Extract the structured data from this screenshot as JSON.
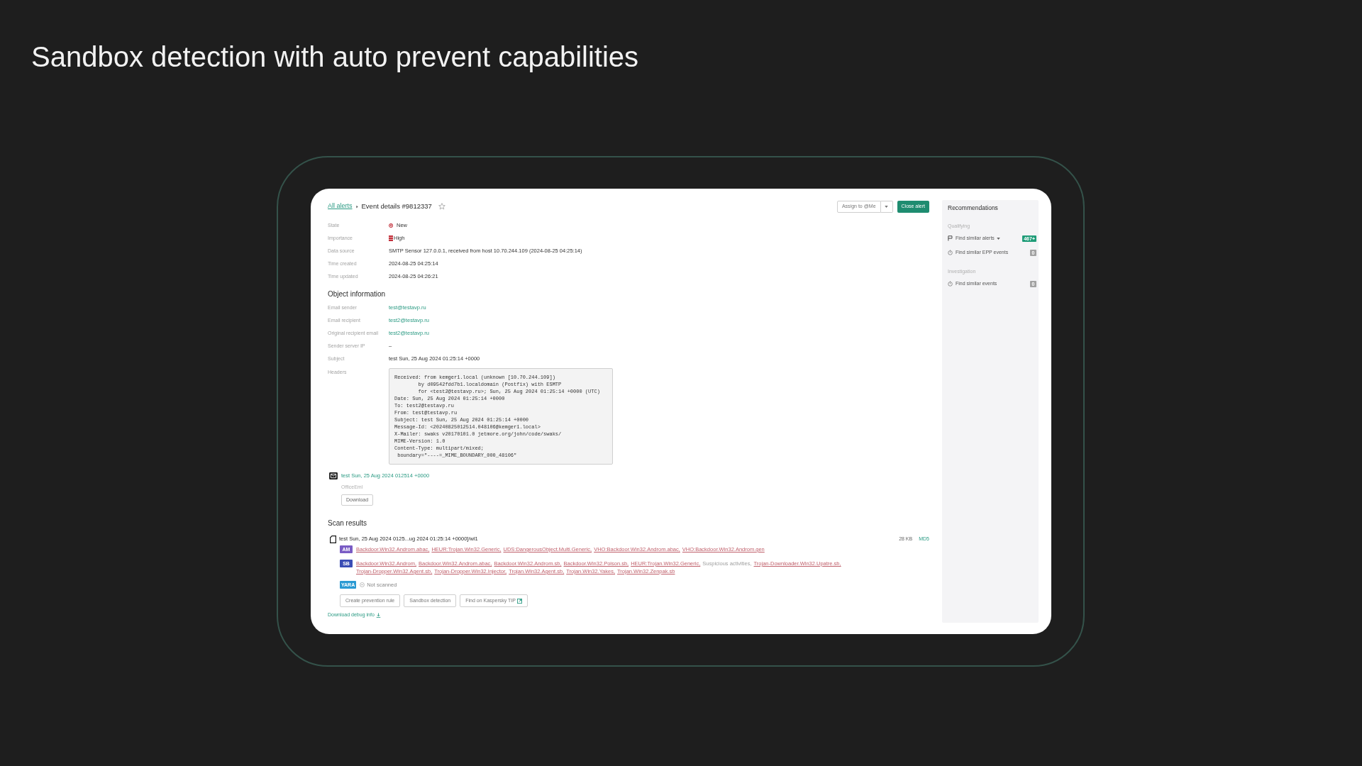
{
  "slide_title": "Sandbox detection with auto prevent capabilities",
  "breadcrumb": {
    "link": "All alerts",
    "current": "Event details #9812337",
    "starred": false
  },
  "actions": {
    "assign": "Assign to @Me",
    "close": "Close alert"
  },
  "details": [
    {
      "label": "State",
      "value": "New",
      "kind": "state"
    },
    {
      "label": "Importance",
      "value": "High",
      "kind": "importance"
    },
    {
      "label": "Data source",
      "value": "SMTP Sensor 127.0.0.1, received from host 10.70.244.109 (2024-08-25 04:25:14)",
      "kind": "text"
    },
    {
      "label": "Time created",
      "value": "2024-08-25 04:25:14",
      "kind": "text"
    },
    {
      "label": "Time updated",
      "value": "2024-08-25 04:26:21",
      "kind": "text"
    }
  ],
  "object_information": {
    "title": "Object information",
    "fields": [
      {
        "label": "Email sender",
        "value": "test@testavp.ru",
        "kind": "link"
      },
      {
        "label": "Email recipient",
        "value": "test2@testavp.ru",
        "kind": "link"
      },
      {
        "label": "Original recipient email",
        "value": "test2@testavp.ru",
        "kind": "link"
      },
      {
        "label": "Sender server IP",
        "value": "–",
        "kind": "text"
      },
      {
        "label": "Subject",
        "value": "test Sun, 25 Aug 2024 01:25:14 +0000",
        "kind": "text"
      },
      {
        "label": "Headers",
        "value": "Received: from kemger1.local (unknown [10.70.244.109])\n        by d09542fdd7b1.localdomain (Postfix) with ESMTP\n        for <test2@testavp.ru>; Sun, 25 Aug 2024 01:25:14 +0000 (UTC)\nDate: Sun, 25 Aug 2024 01:25:14 +0000\nTo: test2@testavp.ru\nFrom: test@testavp.ru\nSubject: test Sun, 25 Aug 2024 01:25:14 +0000\nMessage-Id: <20240825012514.048106@kemger1.local>\nX-Mailer: swaks v20170101.0 jetmore.org/john/code/swaks/\nMIME-Version: 1.0\nContent-Type: multipart/mixed;\n boundary=\"----=_MIME_BOUNDARY_000_48106\"",
        "kind": "code"
      }
    ]
  },
  "attachment": {
    "name": "test Sun, 25 Aug 2024 012514 +0000",
    "type": "OfficeEml",
    "button": "Download"
  },
  "scan_results": {
    "title": "Scan results",
    "file": {
      "name": "test Sun, 25 Aug 2024 0125...ug 2024 01:25:14 +0000]/wl1",
      "size": "28 KB",
      "hash": "MD5"
    },
    "engines": [
      {
        "badge": "AM",
        "color": "#7a5cc4",
        "verdicts": [
          {
            "text": "Backdoor.Win32.Androm.abac,",
            "kind": "link"
          },
          {
            "text": "HEUR:Trojan.Win32.Generic,",
            "kind": "link"
          },
          {
            "text": "UDS:DangerousObject.Multi.Generic,",
            "kind": "link"
          },
          {
            "text": "VHO:Backdoor.Win32.Androm.abac,",
            "kind": "link"
          },
          {
            "text": "VHO:Backdoor.Win32.Androm.gen",
            "kind": "link"
          }
        ]
      },
      {
        "badge": "SB",
        "color": "#3a4db5",
        "verdicts": [
          {
            "text": "Backdoor.Win32.Androm,",
            "kind": "link"
          },
          {
            "text": "Backdoor.Win32.Androm.abac,",
            "kind": "link"
          },
          {
            "text": "Backdoor.Win32.Androm.sb,",
            "kind": "link"
          },
          {
            "text": "Backdoor.Win32.Poison.sb,",
            "kind": "link"
          },
          {
            "text": "HEUR:Trojan.Win32.Generic,",
            "kind": "link"
          },
          {
            "text": "Suspicious activities,",
            "kind": "plain"
          },
          {
            "text": "Trojan-Downloader.Win32.Upatre.sb,",
            "kind": "link"
          },
          {
            "text": "Trojan-Dropper.Win32.Agent.sb,",
            "kind": "link"
          },
          {
            "text": "Trojan-Dropper.Win32.Injector,",
            "kind": "link"
          },
          {
            "text": "Trojan.Win32.Agent.sb,",
            "kind": "link"
          },
          {
            "text": "Trojan.Win32.Yakes,",
            "kind": "link"
          },
          {
            "text": "Trojan.Win32.Zenpak.sb",
            "kind": "link"
          }
        ]
      },
      {
        "badge": "YARA",
        "color": "#2b9ad3",
        "verdicts": [
          {
            "text": "Not scanned",
            "kind": "not_scanned"
          }
        ]
      }
    ],
    "buttons": [
      {
        "label": "Create prevention rule",
        "external": false
      },
      {
        "label": "Sandbox detection",
        "external": false
      },
      {
        "label": "Find on Kaspersky TIP",
        "external": true
      }
    ],
    "debug_link": "Download debug info"
  },
  "recommendations": {
    "title": "Recommendations",
    "groups": [
      {
        "title": "Qualifying",
        "items": [
          {
            "label": "Find similar alerts",
            "kind": "alerts",
            "dropdown": true,
            "count": "467+",
            "color": "#1f9c78"
          },
          {
            "label": "Find similar EPP events",
            "kind": "events",
            "dropdown": false,
            "count": "0",
            "color": "#a3a3a3"
          }
        ]
      },
      {
        "title": "Investigation",
        "items": [
          {
            "label": "Find similar events",
            "kind": "events",
            "dropdown": false,
            "count": "0",
            "color": "#a3a3a3"
          }
        ]
      }
    ]
  }
}
